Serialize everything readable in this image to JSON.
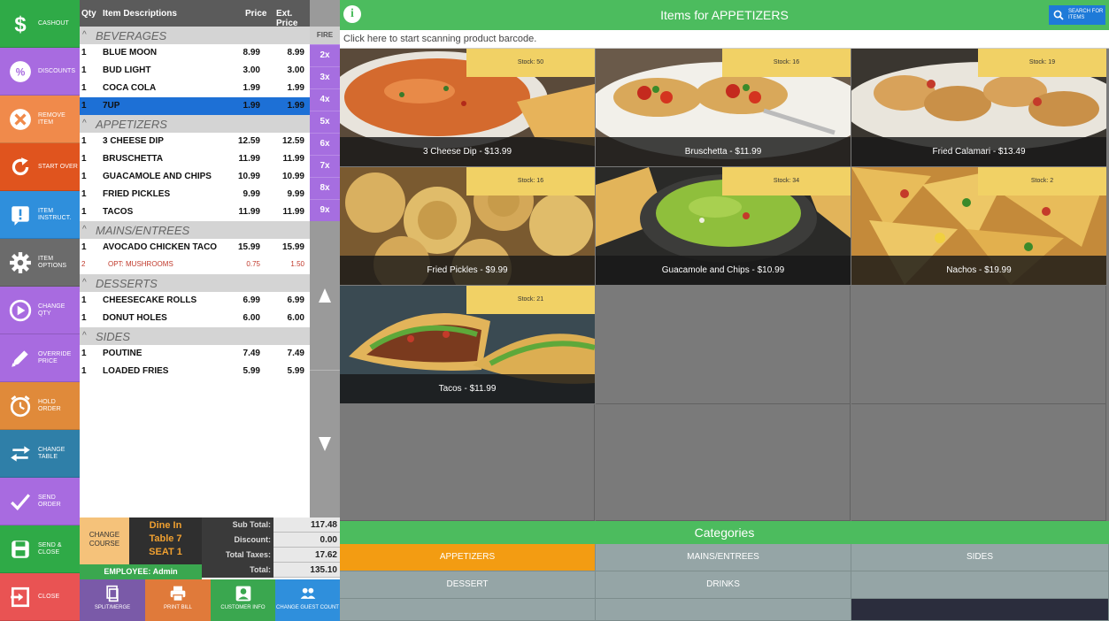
{
  "actions": [
    {
      "label": "CASHOUT",
      "icon": "dollar-icon",
      "color": "#2faa47"
    },
    {
      "label": "DISCOUNTS",
      "icon": "percent-icon",
      "color": "#a86be0"
    },
    {
      "label": "REMOVE ITEM",
      "icon": "remove-icon",
      "color": "#f08a4b"
    },
    {
      "label": "START OVER",
      "icon": "restart-icon",
      "color": "#e0541e"
    },
    {
      "label": "ITEM INSTRUCT.",
      "icon": "instructions-icon",
      "color": "#2f8fdc"
    },
    {
      "label": "ITEM OPTIONS",
      "icon": "gear-icon",
      "color": "#6b6b6b"
    },
    {
      "label": "CHANGE QTY",
      "icon": "change-qty-icon",
      "color": "#a86be0"
    },
    {
      "label": "OVERRIDE PRICE",
      "icon": "pencil-icon",
      "color": "#a86be0"
    },
    {
      "label": "HOLD ORDER",
      "icon": "clock-icon",
      "color": "#e08a3a"
    },
    {
      "label": "CHANGE TABLE",
      "icon": "swap-arrows-icon",
      "color": "#2f7fa8"
    },
    {
      "label": "SEND ORDER",
      "icon": "checkmark-icon",
      "color": "#a86be0"
    },
    {
      "label": "SEND & CLOSE",
      "icon": "save-icon",
      "color": "#2faa47"
    },
    {
      "label": "CLOSE",
      "icon": "exit-icon",
      "color": "#e95353"
    }
  ],
  "order": {
    "headers": {
      "qty": "Qty",
      "desc": "Item Descriptions",
      "price": "Price",
      "ext": "Ext. Price"
    },
    "groups": [
      {
        "name": "BEVERAGES",
        "items": [
          {
            "qty": "1",
            "desc": "BLUE MOON",
            "price": "8.99",
            "ext": "8.99"
          },
          {
            "qty": "1",
            "desc": "BUD LIGHT",
            "price": "3.00",
            "ext": "3.00"
          },
          {
            "qty": "1",
            "desc": "COCA COLA",
            "price": "1.99",
            "ext": "1.99"
          },
          {
            "qty": "1",
            "desc": "7UP",
            "price": "1.99",
            "ext": "1.99",
            "selected": true
          }
        ]
      },
      {
        "name": "APPETIZERS",
        "items": [
          {
            "qty": "1",
            "desc": "3 CHEESE DIP",
            "price": "12.59",
            "ext": "12.59"
          },
          {
            "qty": "1",
            "desc": "BRUSCHETTA",
            "price": "11.99",
            "ext": "11.99"
          },
          {
            "qty": "1",
            "desc": "GUACAMOLE AND CHIPS",
            "price": "10.99",
            "ext": "10.99"
          },
          {
            "qty": "1",
            "desc": "FRIED PICKLES",
            "price": "9.99",
            "ext": "9.99"
          },
          {
            "qty": "1",
            "desc": "TACOS",
            "price": "11.99",
            "ext": "11.99"
          }
        ]
      },
      {
        "name": "MAINS/ENTREES",
        "items": [
          {
            "qty": "1",
            "desc": "AVOCADO CHICKEN TACO",
            "price": "15.99",
            "ext": "15.99"
          },
          {
            "qty": "2",
            "desc": "OPT: MUSHROOMS",
            "price": "0.75",
            "ext": "1.50",
            "option": true
          }
        ]
      },
      {
        "name": "DESSERTS",
        "items": [
          {
            "qty": "1",
            "desc": "CHEESECAKE ROLLS",
            "price": "6.99",
            "ext": "6.99"
          },
          {
            "qty": "1",
            "desc": "DONUT HOLES",
            "price": "6.00",
            "ext": "6.00"
          }
        ]
      },
      {
        "name": "SIDES",
        "items": [
          {
            "qty": "1",
            "desc": "POUTINE",
            "price": "7.49",
            "ext": "7.49"
          },
          {
            "qty": "1",
            "desc": "LOADED FRIES",
            "price": "5.99",
            "ext": "5.99"
          }
        ]
      }
    ]
  },
  "multipliers": {
    "fire": "FIRE",
    "items": [
      "2x",
      "3x",
      "4x",
      "5x",
      "6x",
      "7x",
      "8x",
      "9x"
    ]
  },
  "info": {
    "change_course": "CHANGE COURSE",
    "dine": "Dine In",
    "table": "Table 7",
    "seat": "SEAT 1",
    "employee": "EMPLOYEE: Admin",
    "totals": [
      {
        "label": "Sub Total:",
        "value": "117.48"
      },
      {
        "label": "Discount:",
        "value": "0.00"
      },
      {
        "label": "Total Taxes:",
        "value": "17.62"
      },
      {
        "label": "Total:",
        "value": "135.10"
      }
    ]
  },
  "bottom_buttons": [
    {
      "label": "SPLIT/MERGE",
      "icon": "split-merge-icon",
      "color": "#7a5aa8"
    },
    {
      "label": "PRINT BILL",
      "icon": "printer-icon",
      "color": "#e07a3a"
    },
    {
      "label": "CUSTOMER INFO",
      "icon": "customer-icon",
      "color": "#3aa74f"
    },
    {
      "label": "CHANGE GUEST COUNT",
      "icon": "guests-icon",
      "color": "#2f8fdc"
    }
  ],
  "header": {
    "title": "Items for APPETIZERS",
    "search_label": "SEARCH FOR ITEMS"
  },
  "barcode_prompt": "Click here to start scanning product barcode.",
  "products": [
    {
      "name": "3 Cheese Dip - $13.99",
      "stock": "Stock: 50",
      "theme": "dip"
    },
    {
      "name": "Bruschetta - $11.99",
      "stock": "Stock: 16",
      "theme": "bruschetta"
    },
    {
      "name": "Fried Calamari - $13.49",
      "stock": "Stock: 19",
      "theme": "calamari"
    },
    {
      "name": "Fried Pickles - $9.99",
      "stock": "Stock: 16",
      "theme": "pickles"
    },
    {
      "name": "Guacamole and Chips - $10.99",
      "stock": "Stock: 34",
      "theme": "guac"
    },
    {
      "name": "Nachos - $19.99",
      "stock": "Stock: 2",
      "theme": "nachos"
    },
    {
      "name": "Tacos - $11.99",
      "stock": "Stock: 21",
      "theme": "tacos"
    }
  ],
  "categories": {
    "title": "Categories",
    "items": [
      "APPETIZERS",
      "MAINS/ENTREES",
      "SIDES",
      "DESSERT",
      "DRINKS"
    ],
    "active": "APPETIZERS",
    "active_color": "#f39c12",
    "button_color": "#95a5a6"
  }
}
